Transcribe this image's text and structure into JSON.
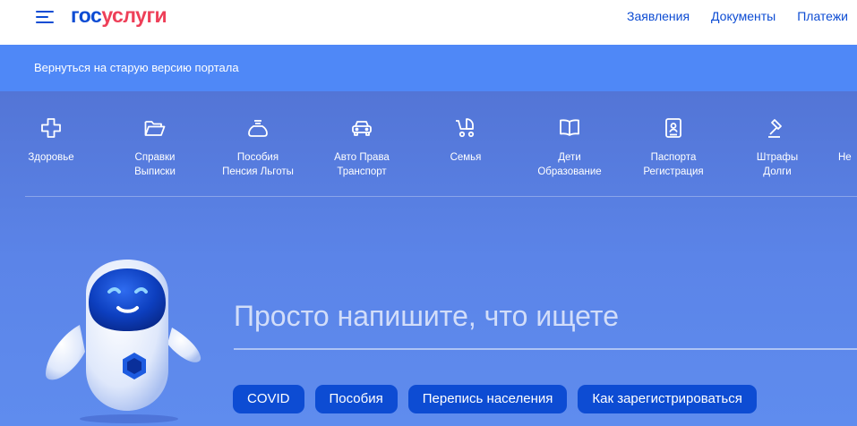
{
  "header": {
    "logo_part1": "гос",
    "logo_part2": "услуги",
    "nav": [
      "Заявления",
      "Документы",
      "Платежи"
    ]
  },
  "banner": {
    "link": "Вернуться на старую версию портала"
  },
  "categories": [
    {
      "label": "Здоровье",
      "icon": "health-cross-icon"
    },
    {
      "label": "Справки\nВыписки",
      "icon": "folder-icon"
    },
    {
      "label": "Пособия\nПенсия Льготы",
      "icon": "wallet-icon"
    },
    {
      "label": "Авто Права\nТранспорт",
      "icon": "car-icon"
    },
    {
      "label": "Семья",
      "icon": "stroller-icon"
    },
    {
      "label": "Дети\nОбразование",
      "icon": "book-icon"
    },
    {
      "label": "Паспорта\nРегистрация",
      "icon": "passport-icon"
    },
    {
      "label": "Штрафы\nДолги",
      "icon": "gavel-icon"
    },
    {
      "label": "Не",
      "icon": "more-icon"
    }
  ],
  "search": {
    "placeholder": "Просто напишите, что ищете"
  },
  "chips": [
    "COVID",
    "Пособия",
    "Перепись населения",
    "Как зарегистрироваться"
  ],
  "colors": {
    "brand_blue": "#0d4cd3",
    "brand_red": "#ee3f58",
    "banner": "#4f88f7",
    "hero": "#5379d8"
  }
}
